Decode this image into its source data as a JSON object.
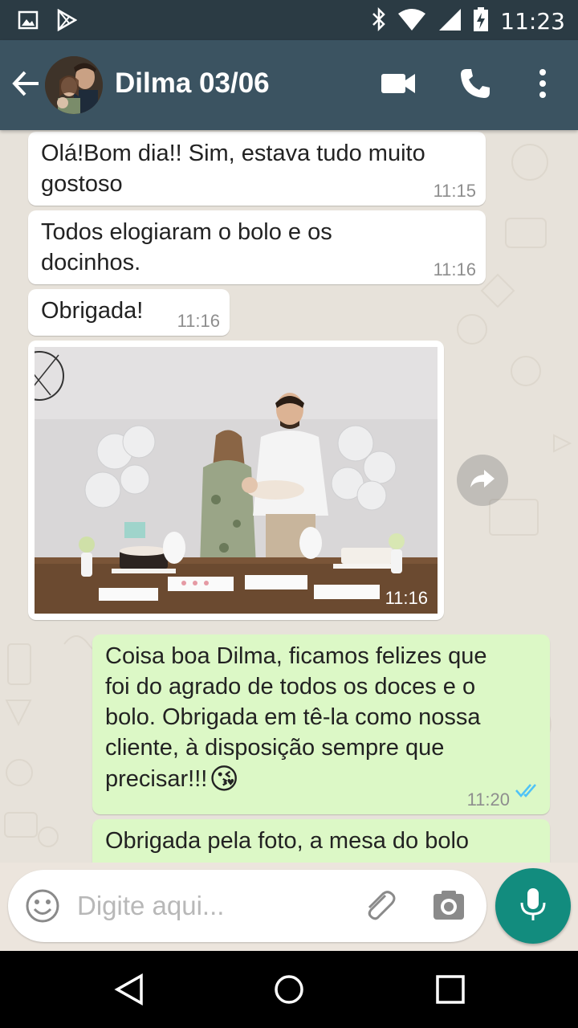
{
  "status_bar": {
    "time": "11:23",
    "icons": [
      "image-icon",
      "play-store-icon",
      "bluetooth-icon",
      "wifi-icon",
      "signal-icon",
      "battery-charging-icon"
    ]
  },
  "header": {
    "title": "Dilma 03/06",
    "icons": [
      "back-arrow-icon",
      "video-call-icon",
      "phone-icon",
      "more-vert-icon"
    ]
  },
  "messages": [
    {
      "direction": "in",
      "text_lines": [
        "Olá!Bom dia!! Sim, estava tudo muito",
        "gostoso"
      ],
      "time": "11:15"
    },
    {
      "direction": "in",
      "text_lines": [
        "Todos elogiaram o bolo e os",
        "docinhos."
      ],
      "time": "11:16"
    },
    {
      "direction": "in",
      "text_lines": [
        "Obrigada!"
      ],
      "time": "11:16"
    },
    {
      "direction": "in",
      "type": "image",
      "time": "11:16"
    },
    {
      "direction": "out",
      "text_lines": [
        "Coisa boa Dilma, ficamos felizes que",
        "foi do agrado de todos os doces e o",
        "bolo. Obrigada em tê-la como nossa",
        "cliente, à disposição sempre que",
        "precisar!!!"
      ],
      "emoji": "😘",
      "time": "11:20",
      "status": "read"
    },
    {
      "direction": "out",
      "text_lines": [
        "Obrigada pela foto, a mesa do bolo"
      ],
      "partial": true
    }
  ],
  "composer": {
    "placeholder": "Digite aqui...",
    "icons": [
      "emoji-icon",
      "attach-icon",
      "camera-icon",
      "mic-icon"
    ]
  },
  "colors": {
    "header": "#3b5361",
    "status_bar": "#2b3b44",
    "outgoing_bubble": "#dcf8c6",
    "incoming_bubble": "#ffffff",
    "mic_button": "#128c7e",
    "read_ticks": "#4fc3f7"
  }
}
